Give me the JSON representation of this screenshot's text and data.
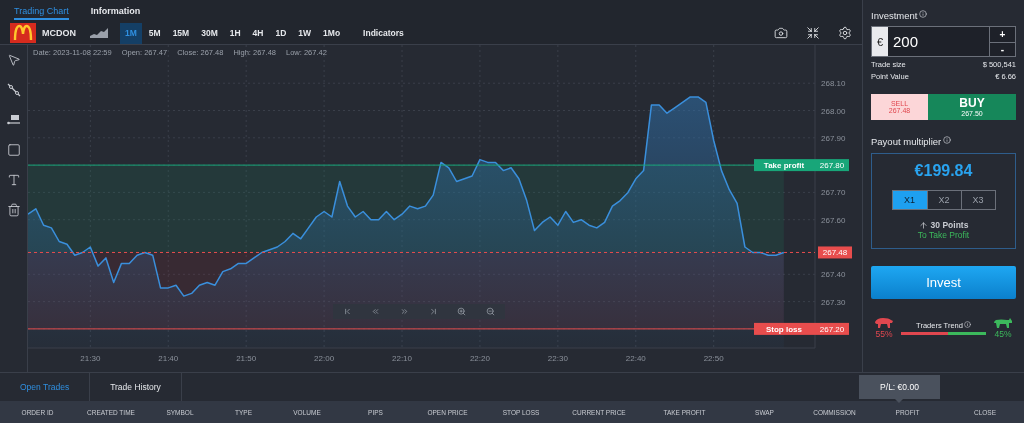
{
  "tabs": [
    {
      "label": "Trading Chart",
      "selected": true
    },
    {
      "label": "Information",
      "selected": false
    }
  ],
  "symbol": "MCDON",
  "timeframes": [
    {
      "label": "1M",
      "selected": true
    },
    {
      "label": "5M",
      "selected": false
    },
    {
      "label": "15M",
      "selected": false
    },
    {
      "label": "30M",
      "selected": false
    },
    {
      "label": "1H",
      "selected": false
    },
    {
      "label": "4H",
      "selected": false
    },
    {
      "label": "1D",
      "selected": false
    },
    {
      "label": "1W",
      "selected": false
    },
    {
      "label": "1Mo",
      "selected": false
    }
  ],
  "indicators": "Indicators",
  "ohlc": [
    "Date: 2023-11-08 22:59",
    "Open: 267.47",
    "Close: 267.48",
    "High: 267.48",
    "Low: 267.42"
  ],
  "chart": {
    "chart_data": {
      "type": "area",
      "grid": true,
      "categories": [
        null,
        null,
        null,
        null,
        null,
        null,
        null,
        null,
        "21:30",
        null,
        null,
        null,
        null,
        null,
        null,
        null,
        null,
        null,
        "21:40",
        null,
        null,
        null,
        null,
        null,
        null,
        null,
        null,
        null,
        "21:50",
        null,
        null,
        null,
        null,
        null,
        null,
        null,
        null,
        null,
        "22:00",
        null,
        null,
        null,
        null,
        null,
        null,
        null,
        null,
        null,
        "22:10",
        null,
        null,
        null,
        null,
        null,
        null,
        null,
        null,
        null,
        "22:20",
        null,
        null,
        null,
        null,
        null,
        null,
        null,
        null,
        null,
        "22:30",
        null,
        null,
        null,
        null,
        null,
        null,
        null,
        null,
        null,
        "22:40",
        null,
        null,
        null,
        null,
        null,
        null,
        null,
        null,
        null,
        "22:50",
        null,
        null,
        null,
        null,
        null,
        null,
        null,
        null,
        null
      ],
      "series": [
        {
          "color": "#3a8fdc",
          "values": [
            267.62,
            267.64,
            267.58,
            267.57,
            267.52,
            267.51,
            267.47,
            267.48,
            267.5,
            267.43,
            267.46,
            267.37,
            267.44,
            267.44,
            267.47,
            267.48,
            267.47,
            267.35,
            267.35,
            267.36,
            267.32,
            267.33,
            267.36,
            267.37,
            267.36,
            267.41,
            267.42,
            267.44,
            267.44,
            267.46,
            267.48,
            267.49,
            267.5,
            267.52,
            267.55,
            267.53,
            267.57,
            267.61,
            267.63,
            267.61,
            267.74,
            267.65,
            267.61,
            267.63,
            267.6,
            267.6,
            267.63,
            267.6,
            267.62,
            267.65,
            267.64,
            267.65,
            267.69,
            267.81,
            267.79,
            267.74,
            267.75,
            267.76,
            267.82,
            267.81,
            267.81,
            267.78,
            267.79,
            267.75,
            267.67,
            267.56,
            267.59,
            267.61,
            267.58,
            267.63,
            267.59,
            267.6,
            267.58,
            267.57,
            267.59,
            267.65,
            267.67,
            267.7,
            267.75,
            267.78,
            268.02,
            268.02,
            267.99,
            268.01,
            268.03,
            268.05,
            268.05,
            268.03,
            267.89,
            267.78,
            267.71,
            267.66,
            267.5,
            267.48,
            267.48,
            267.47,
            267.47,
            267.48
          ]
        }
      ],
      "ylim": [
        267.13,
        268.24
      ],
      "yticks": [
        {
          "value": 268.1,
          "label": "268.10"
        },
        {
          "value": 268.0,
          "label": "268.00"
        },
        {
          "value": 267.9,
          "label": "267.90"
        },
        {
          "value": 267.8,
          "label": "267.80"
        },
        {
          "value": 267.7,
          "label": "267.70"
        },
        {
          "value": 267.6,
          "label": "267.60"
        },
        {
          "value": 267.4,
          "label": "267.40"
        },
        {
          "value": 267.3,
          "label": "267.30"
        },
        {
          "value": 267.2,
          "label": "267.20"
        }
      ],
      "ref_lines": [
        {
          "axis": "y",
          "value": 267.8,
          "label": "Take profit",
          "color": "#18a679"
        },
        {
          "axis": "y",
          "value": 267.48,
          "label": "267.48",
          "color": "#e84d4d"
        },
        {
          "axis": "y",
          "value": 267.2,
          "label": "Stop loss",
          "color": "#e84d4d"
        }
      ],
      "bands": [
        {
          "axis": "y",
          "from": 267.48,
          "to": 267.8,
          "color": "#1a7f5e"
        },
        {
          "axis": "y",
          "from": 267.2,
          "to": 267.48,
          "color": "#8a2f3a"
        }
      ]
    }
  },
  "investment": {
    "title": "Investment",
    "currency": "€",
    "value": "200",
    "plus": "+",
    "minus": "-",
    "trade_size_label": "Trade size",
    "trade_size": "$ 500,541",
    "point_value_label": "Point Value",
    "point_value": "€ 6.66"
  },
  "sell": {
    "label": "SELL",
    "price": "267.48"
  },
  "buy": {
    "label": "BUY",
    "price": "267.50"
  },
  "payout": {
    "title": "Payout multiplier",
    "amount": "€199.84",
    "multipliers": [
      {
        "label": "X1",
        "selected": true
      },
      {
        "label": "X2",
        "selected": false
      },
      {
        "label": "X3",
        "selected": false
      }
    ],
    "points": "30 Points",
    "target": "To Take Profit"
  },
  "invest_button": "Invest",
  "traders_trend": {
    "title": "Traders Trend",
    "bear": "55%",
    "bull": "45%",
    "level": 0.55
  },
  "bottom_tabs": [
    {
      "label": "Open Trades",
      "selected": true
    },
    {
      "label": "Trade History",
      "selected": false
    }
  ],
  "pl": "P/L: €0.00",
  "columns": [
    "ORDER ID",
    "CREATED TIME",
    "SYMBOL",
    "TYPE",
    "VOLUME",
    "PIPS",
    "OPEN PRICE",
    "STOP LOSS",
    "CURRENT PRICE",
    "TAKE PROFIT",
    "SWAP",
    "COMMISSION",
    "PROFIT",
    "CLOSE"
  ]
}
